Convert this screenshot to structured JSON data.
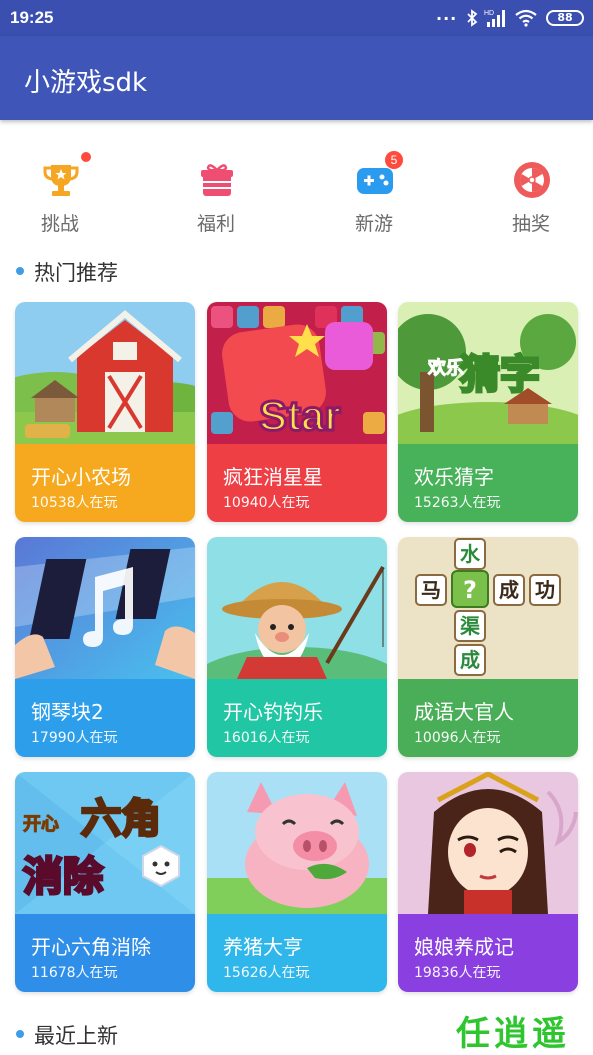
{
  "status_bar": {
    "time": "19:25",
    "dots": "...",
    "signal_label": "HD",
    "battery": "88"
  },
  "app_bar": {
    "title": "小游戏sdk"
  },
  "quick_nav": [
    {
      "label": "挑战",
      "icon": "trophy-icon",
      "color": "#f5a623",
      "indicator": "dot"
    },
    {
      "label": "福利",
      "icon": "gift-icon",
      "color": "#ef4d72",
      "indicator": ""
    },
    {
      "label": "新游",
      "icon": "gamepad-icon",
      "color": "#2b9bf0",
      "badge": "5"
    },
    {
      "label": "抽奖",
      "icon": "lottery-wheel-icon",
      "color": "#ef5a5a",
      "indicator": ""
    }
  ],
  "sections": {
    "hot": "热门推荐",
    "new": "最近上新"
  },
  "games": [
    {
      "name": "开心小农场",
      "players": "10538人在玩",
      "color": "#f6a91e",
      "art": "farm-barn-art"
    },
    {
      "name": "疯狂消星星",
      "players": "10940人在玩",
      "color": "#ee3f45",
      "art": "star-puzzle-art"
    },
    {
      "name": "欢乐猜字",
      "players": "15263人在玩",
      "color": "#48b25a",
      "art": "word-guess-art"
    },
    {
      "name": "钢琴块2",
      "players": "17990人在玩",
      "color": "#2c9eea",
      "art": "piano-tiles-art"
    },
    {
      "name": "开心钓钓乐",
      "players": "16016人在玩",
      "color": "#21c6a4",
      "art": "fisherman-art"
    },
    {
      "name": "成语大官人",
      "players": "10096人在玩",
      "color": "#4aae58",
      "art": "idiom-tiles-art"
    },
    {
      "name": "开心六角消除",
      "players": "11678人在玩",
      "color": "#2f8ee8",
      "art": "hexagon-elimination-art"
    },
    {
      "name": "养猪大亨",
      "players": "15626人在玩",
      "color": "#2fb6ea",
      "art": "pig-art"
    },
    {
      "name": "娘娘养成记",
      "players": "19836人在玩",
      "color": "#8a3fe0",
      "art": "empress-art"
    }
  ],
  "idiom_tiles": [
    "水",
    "马",
    "?",
    "成",
    "功",
    "渠",
    "成"
  ],
  "art_text": {
    "star": "Star",
    "word_guess_top": "欢乐",
    "word_guess_main": "猜字",
    "hex_top": "开心",
    "hex_main1": "六角",
    "hex_main2": "消除"
  },
  "watermark": "任逍遥"
}
